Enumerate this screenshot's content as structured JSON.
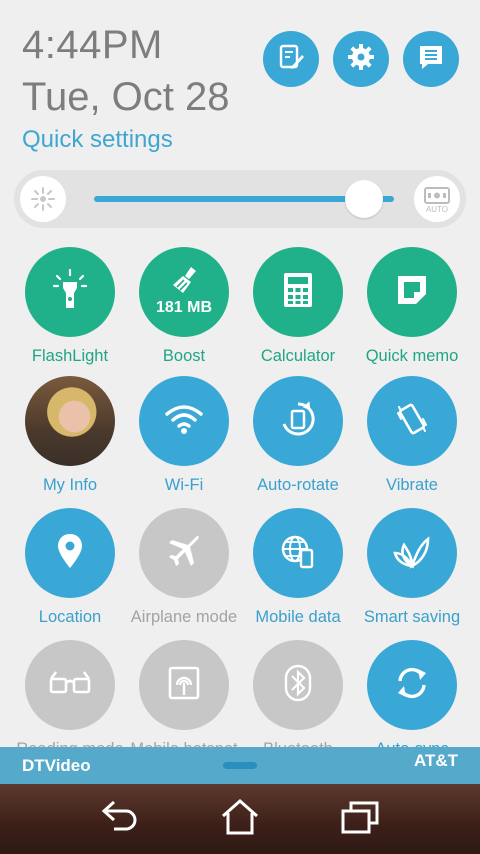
{
  "header": {
    "time": "4:44",
    "ampm": "PM",
    "date": "Tue, Oct 28",
    "quick_settings_label": "Quick settings"
  },
  "top_buttons": [
    {
      "name": "edit-notes-button",
      "icon": "edit-icon"
    },
    {
      "name": "settings-button",
      "icon": "gear-icon"
    },
    {
      "name": "notifications-list-button",
      "icon": "list-icon"
    }
  ],
  "brightness": {
    "level": 0.9,
    "auto_label": "AUTO"
  },
  "tiles": [
    {
      "label": "FlashLight",
      "state": "on",
      "color": "#21b18a",
      "icon": "flashlight-icon"
    },
    {
      "label": "Boost",
      "sub": "181 MB",
      "state": "on",
      "color": "#21b18a",
      "icon": "broom-icon"
    },
    {
      "label": "Calculator",
      "state": "on",
      "color": "#21b18a",
      "icon": "calculator-icon"
    },
    {
      "label": "Quick memo",
      "state": "on",
      "color": "#21b18a",
      "icon": "memo-icon"
    },
    {
      "label": "My Info",
      "state": "on",
      "icon": "avatar"
    },
    {
      "label": "Wi-Fi",
      "state": "on",
      "color": "#3aa8d6",
      "icon": "wifi-icon"
    },
    {
      "label": "Auto-rotate",
      "state": "on",
      "color": "#3aa8d6",
      "icon": "rotate-icon"
    },
    {
      "label": "Vibrate",
      "state": "on",
      "color": "#3aa8d6",
      "icon": "vibrate-icon"
    },
    {
      "label": "Location",
      "state": "on",
      "color": "#3aa8d6",
      "icon": "location-pin-icon"
    },
    {
      "label": "Airplane mode",
      "state": "off",
      "color": "#c7c7c7",
      "icon": "airplane-icon"
    },
    {
      "label": "Mobile data",
      "state": "on",
      "color": "#3aa8d6",
      "icon": "globe-phone-icon"
    },
    {
      "label": "Smart saving",
      "state": "on",
      "color": "#3aa8d6",
      "icon": "leaf-icon"
    },
    {
      "label": "Reading mode",
      "state": "off",
      "color": "#c7c7c7",
      "icon": "glasses-icon"
    },
    {
      "label": "Mobile hotspot",
      "state": "off",
      "color": "#c7c7c7",
      "icon": "hotspot-icon"
    },
    {
      "label": "Bluetooth",
      "state": "off",
      "color": "#c7c7c7",
      "icon": "bluetooth-icon"
    },
    {
      "label": "Auto-sync",
      "state": "on",
      "color": "#3aa8d6",
      "icon": "sync-icon"
    }
  ],
  "notification_bar": {
    "app": "DTVideo",
    "carrier": "AT&T"
  },
  "navbar": {
    "buttons": [
      "back-icon",
      "home-icon",
      "recent-apps-icon"
    ]
  }
}
